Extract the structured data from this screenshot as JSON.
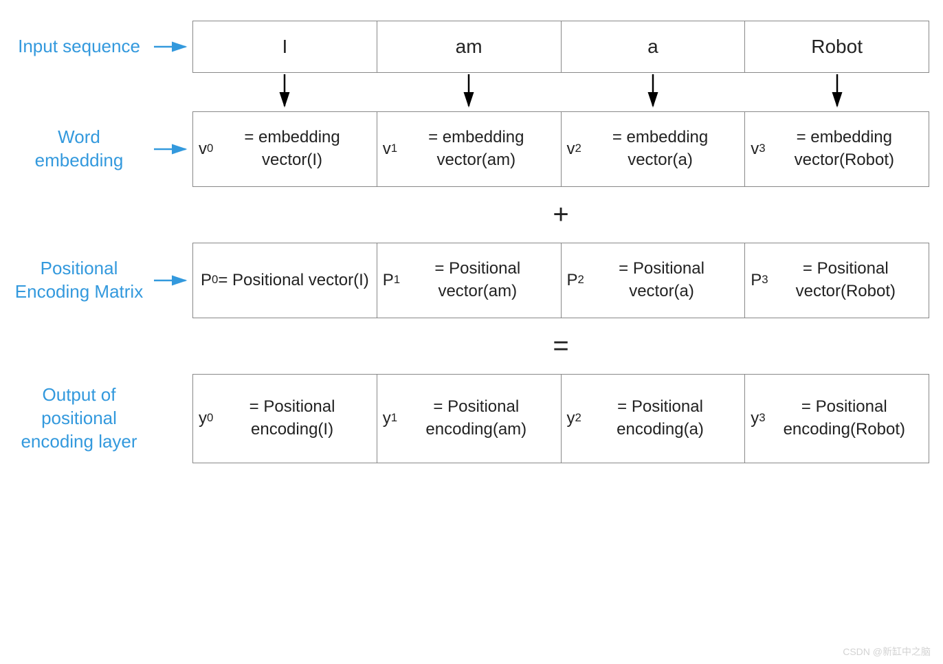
{
  "labels": {
    "input": "Input sequence",
    "word": "Word embedding",
    "pos": "Positional Encoding Matrix",
    "out": "Output of positional encoding layer"
  },
  "ops": {
    "plus": "+",
    "eq": "="
  },
  "input_row": [
    "I",
    "am",
    "a",
    "Robot"
  ],
  "word_row": [
    "v<sub>0</sub> = embedding vector(I)",
    "v<sub>1</sub> = embedding vector(am)",
    "v<sub>2</sub> = embedding vector(a)",
    "v<sub>3</sub> = embedding vector(Robot)"
  ],
  "pos_row": [
    "P<sub>0</sub> = Positional vector(I)",
    "P<sub>1</sub> = Positional vector(am)",
    "P<sub>2</sub> = Positional vector(a)",
    "P<sub>3</sub> = Positional vector(Robot)"
  ],
  "out_row": [
    "y<sub>0</sub> = Positional encoding(I)",
    "y<sub>1</sub> = Positional encoding(am)",
    "y<sub>2</sub> = Positional encoding(a)",
    "y<sub>3</sub> = Positional encoding(Robot)"
  ],
  "watermark": "CSDN @新缸中之脑"
}
